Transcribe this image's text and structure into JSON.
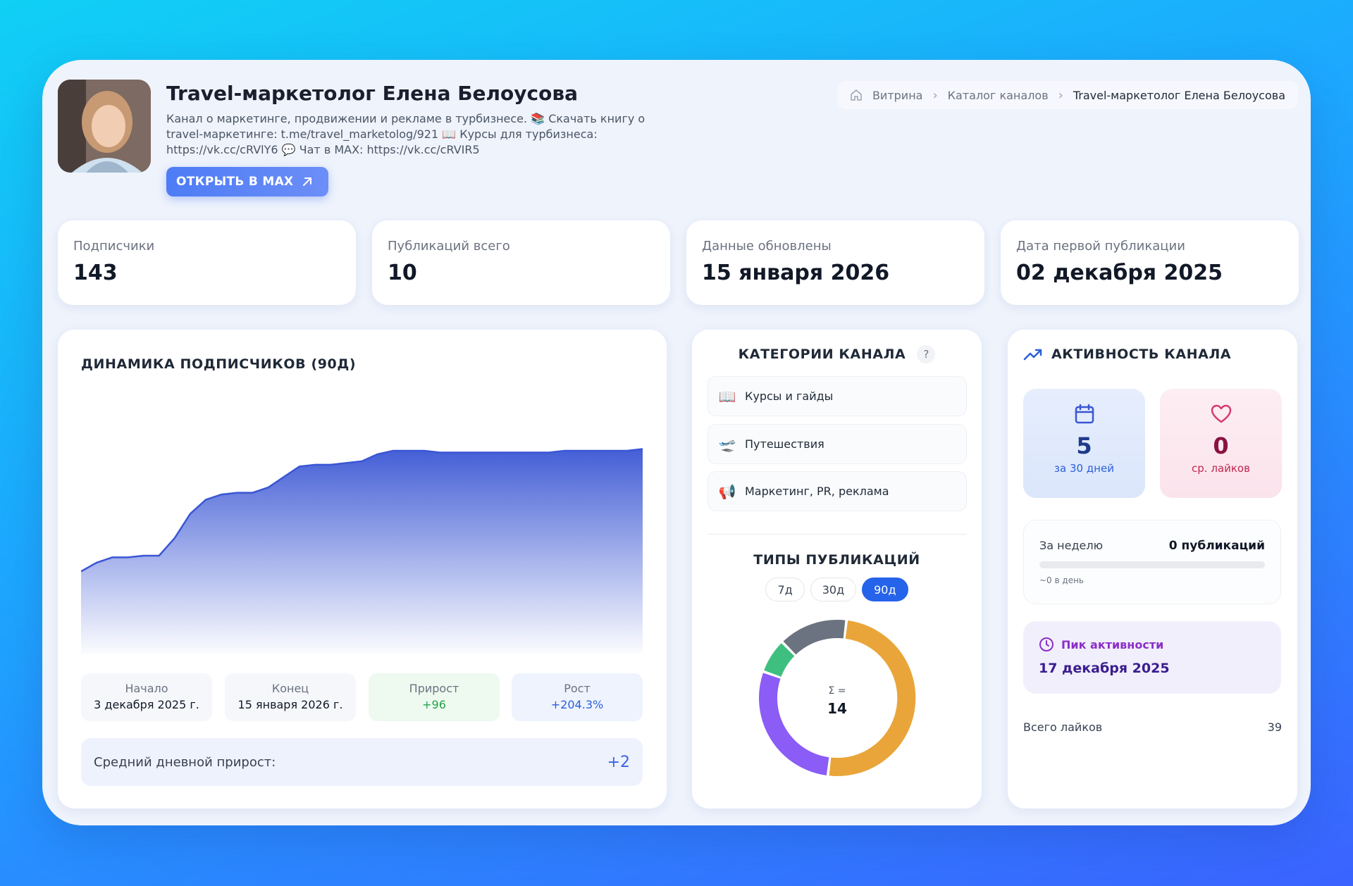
{
  "channel": {
    "title": "Travel-маркетолог Елена Белоусова",
    "description": "Канал о маркетинге, продвижении и рекламе в турбизнесе. 📚 Скачать книгу о travel-маркетинге: t.me/travel_marketolog/921 📖 Курсы для турбизнеса: https://vk.cc/cRVlY6 💬 Чат в MAX: https://vk.cc/cRVIR5",
    "open_button": "ОТКРЫТЬ В MAX"
  },
  "breadcrumb": {
    "items": [
      "Витрина",
      "Каталог каналов",
      "Travel-маркетолог Елена Белоусова"
    ]
  },
  "stats": [
    {
      "label": "Подписчики",
      "value": "143"
    },
    {
      "label": "Публикаций всего",
      "value": "10"
    },
    {
      "label": "Данные обновлены",
      "value": "15 января 2026"
    },
    {
      "label": "Дата первой публикации",
      "value": "02 декабря 2025"
    }
  ],
  "dynamics": {
    "title": "ДИНАМИКА ПОДПИСЧИКОВ (90Д)",
    "summary": [
      {
        "label": "Начало",
        "value": "3 декабря 2025 г."
      },
      {
        "label": "Конец",
        "value": "15 января 2026 г."
      },
      {
        "label": "Прирост",
        "value": "+96"
      },
      {
        "label": "Рост",
        "value": "+204.3%"
      }
    ],
    "avg_label": "Средний дневной прирост:",
    "avg_value": "+2"
  },
  "chart_data": [
    {
      "type": "area",
      "values": [
        47,
        52,
        55,
        55,
        56,
        56,
        66,
        80,
        88,
        91,
        92,
        92,
        95,
        101,
        107,
        108,
        108,
        109,
        110,
        114,
        116,
        116,
        116,
        115,
        115,
        115,
        115,
        115,
        115,
        115,
        115,
        116,
        116,
        116,
        116,
        116,
        117
      ],
      "ylim": [
        0,
        145
      ],
      "color": "#3a56d4"
    },
    {
      "type": "pie",
      "title": "ТИПЫ ПУБЛИКАЦИЙ",
      "center_label": "Σ =",
      "center_value": "14",
      "values": [
        7,
        4,
        1,
        2
      ],
      "colors": [
        "#e9a53a",
        "#8b5cf6",
        "#3fbf7f",
        "#6b7280"
      ]
    }
  ],
  "categories": {
    "title": "КАТЕГОРИИ КАНАЛА",
    "help": "?",
    "items": [
      {
        "icon": "📖",
        "label": "Курсы и гайды"
      },
      {
        "icon": "🛫",
        "label": "Путешествия"
      },
      {
        "icon": "📢",
        "label": "Маркетинг, PR, реклама"
      }
    ]
  },
  "publication_types": {
    "title": "ТИПЫ ПУБЛИКАЦИЙ",
    "tabs": [
      "7д",
      "30д",
      "90д"
    ],
    "active_tab": "90д"
  },
  "activity": {
    "title": "АКТИВНОСТЬ КАНАЛА",
    "posts_30d": {
      "value": "5",
      "caption": "за 30 дней"
    },
    "avg_likes": {
      "value": "0",
      "caption": "ср. лайков"
    },
    "week_label": "За неделю",
    "week_value": "0 публикаций",
    "week_sub": "~0 в день",
    "peak_label": "Пик активности",
    "peak_value": "17 декабря 2025",
    "total_likes_label": "Всего лайков",
    "total_likes_value": "39"
  }
}
